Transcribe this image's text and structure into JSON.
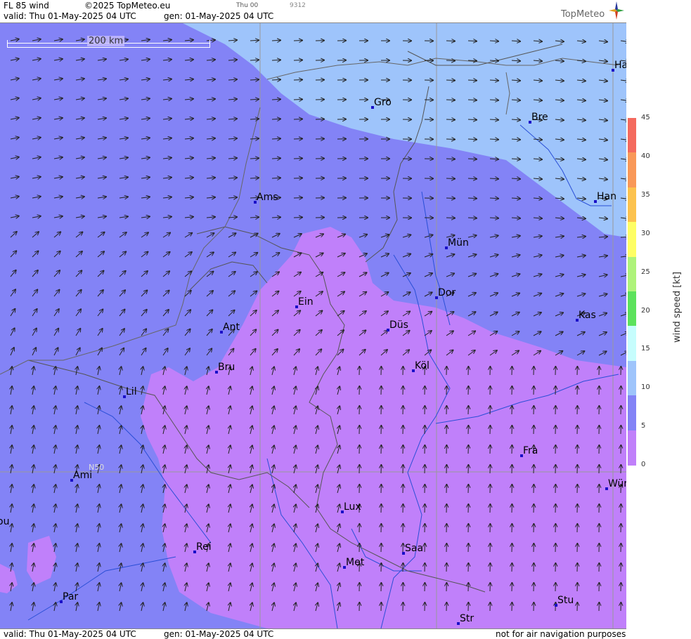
{
  "header": {
    "product": "FL 85 wind",
    "copyright": "©2025 TopMeteo.eu",
    "run": "Thu 00",
    "code": "9312",
    "valid": "valid:  Thu  01-May-2025  04 UTC",
    "gen": "gen: 01-May-2025 04 UTC",
    "logo": "TopMeteo"
  },
  "footer": {
    "valid": "valid:  Thu  01-May-2025  04 UTC",
    "gen": "gen: 01-May-2025 04 UTC",
    "disclaimer": "not for air navigation purposes"
  },
  "map": {
    "scale_label": "200 km",
    "lat_label": "N50",
    "cities": [
      {
        "name": "Ha"
      },
      {
        "name": "Gro"
      },
      {
        "name": "Bre"
      },
      {
        "name": "Ams"
      },
      {
        "name": "Han"
      },
      {
        "name": "Mün"
      },
      {
        "name": "Ein"
      },
      {
        "name": "Dor"
      },
      {
        "name": "Kas"
      },
      {
        "name": "Ant"
      },
      {
        "name": "Düs"
      },
      {
        "name": "Bru"
      },
      {
        "name": "Köl"
      },
      {
        "name": "Lil"
      },
      {
        "name": "Fra"
      },
      {
        "name": "Ami"
      },
      {
        "name": "Wür"
      },
      {
        "name": "Lux"
      },
      {
        "name": "ou"
      },
      {
        "name": "Rei"
      },
      {
        "name": "Saa"
      },
      {
        "name": "Met"
      },
      {
        "name": "Par"
      },
      {
        "name": "Stu"
      },
      {
        "name": "Str"
      }
    ]
  },
  "legend": {
    "title": "wind  speed  [kt]",
    "ticks": [
      "45",
      "40",
      "35",
      "30",
      "25",
      "20",
      "15",
      "10",
      "5",
      "0"
    ],
    "colors": [
      "#f46a5e",
      "#f99858",
      "#fcc24e",
      "#fefe64",
      "#aef37a",
      "#5ce25c",
      "#c6fdfd",
      "#9ec4fb",
      "#8383f6",
      "#c080fa"
    ]
  },
  "colors": {
    "band_0_5": "#c080fa",
    "band_5_10": "#8383f6",
    "band_10_15": "#9ec4fb"
  }
}
